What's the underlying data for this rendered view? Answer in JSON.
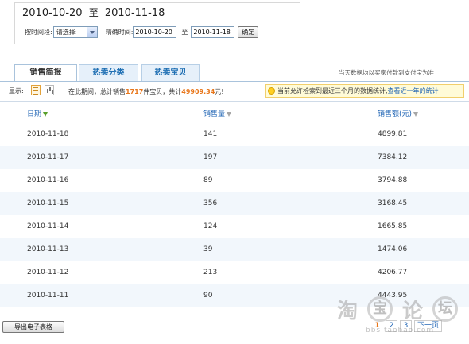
{
  "range": {
    "start": "2010-10-20",
    "sep": "至",
    "end": "2010-11-18"
  },
  "filter": {
    "period_label": "按时间段:",
    "period_value": "请选择",
    "exact_label": "精确时间:",
    "start_value": "2010-10-20",
    "to": "至",
    "end_value": "2010-11-18",
    "ok_label": "确定"
  },
  "tabs": [
    {
      "label": "销售简报"
    },
    {
      "label": "热卖分类"
    },
    {
      "label": "热卖宝贝"
    }
  ],
  "notice_right": "当天数据均以买家付款到支付宝为准",
  "toolbar": {
    "display_label": "显示:",
    "summary_prefix": "在此期间，总计销售",
    "summary_count": "1717",
    "summary_mid": "件宝贝，共计",
    "summary_amount": "49909.34",
    "summary_suffix": "元!",
    "tip_text": "当前允许检索到最近三个月的数据统计,",
    "tip_link": "查看近一年的统计"
  },
  "table": {
    "headers": [
      "日期",
      "销售量",
      "销售额(元)"
    ],
    "rows": [
      [
        "2010-11-18",
        "141",
        "4899.81"
      ],
      [
        "2010-11-17",
        "197",
        "7384.12"
      ],
      [
        "2010-11-16",
        "89",
        "3794.88"
      ],
      [
        "2010-11-15",
        "356",
        "3168.45"
      ],
      [
        "2010-11-14",
        "124",
        "1665.85"
      ],
      [
        "2010-11-13",
        "39",
        "1474.06"
      ],
      [
        "2010-11-12",
        "213",
        "4206.77"
      ],
      [
        "2010-11-11",
        "90",
        "4443.95"
      ]
    ]
  },
  "export_label": "导出电子表格",
  "pager": {
    "pages": [
      "1",
      "2",
      "3"
    ],
    "current": "1",
    "next_label": "下一页"
  },
  "watermark": {
    "chars": [
      "淘",
      "宝",
      "论",
      "坛"
    ],
    "url": "bbs.taobao.com"
  },
  "colors": {
    "link": "#1f64b4",
    "highlight": "#e8761a",
    "row_alt": "#f2f7fc",
    "tab_border": "#a9c3dc"
  }
}
